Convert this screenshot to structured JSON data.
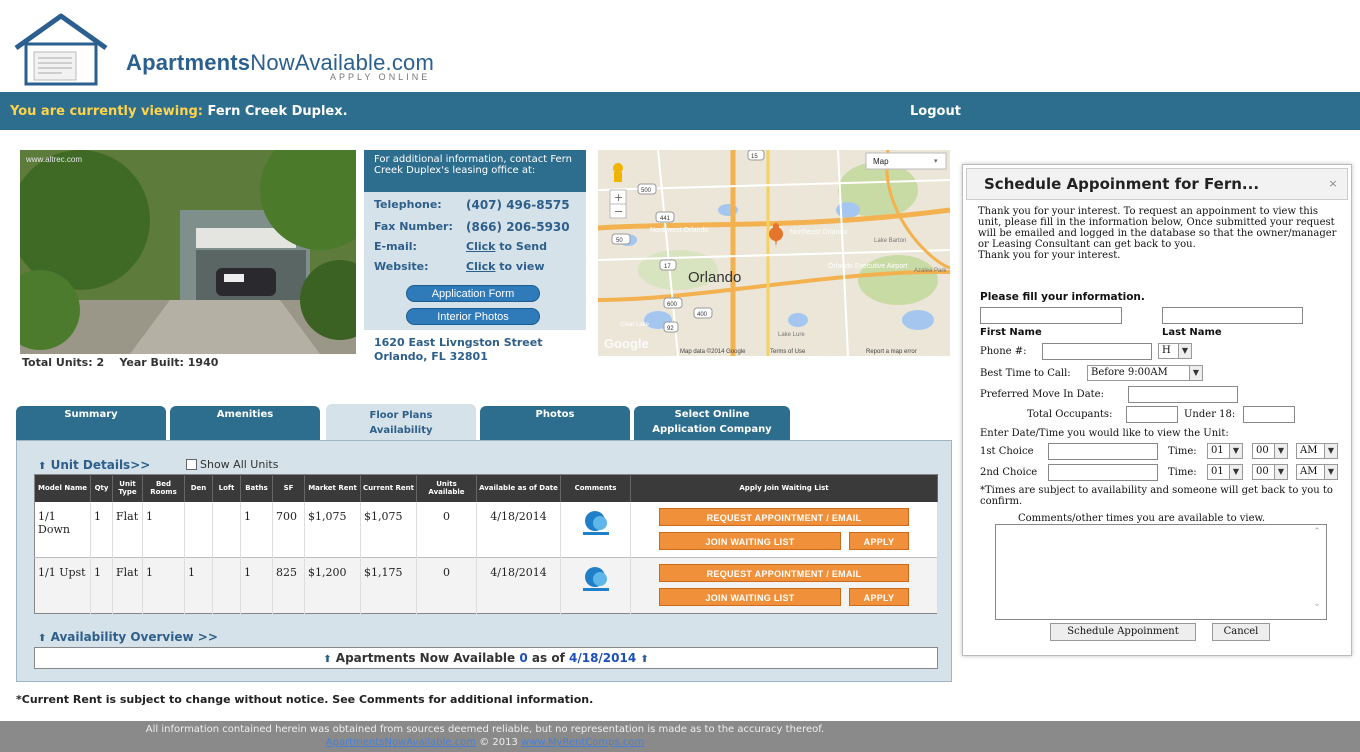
{
  "header": {
    "brand_bold": "Apartments",
    "brand_rest": "NowAvailable.com",
    "brand_sub": "APPLY ONLINE",
    "viewing_label": "You are currently viewing:",
    "viewing_value": "Fern Creek Duplex.",
    "logout": "Logout"
  },
  "property": {
    "photo_watermark": "www.altrec.com",
    "total_units": "Total Units: 2",
    "year_built": "Year Built: 1940",
    "contact_intro": "For additional information, contact Fern Creek Duplex's leasing office at:",
    "telephone_label": "Telephone:",
    "telephone": "(407) 496-8575",
    "fax_label": "Fax Number:",
    "fax": "(866) 206-5930",
    "email_label": "E-mail:",
    "email_link_click": "Click",
    "email_link_rest": " to Send",
    "website_label": "Website:",
    "website_link_click": "Click",
    "website_link_rest": " to view",
    "application_form": "Application Form",
    "interior_photos": "Interior Photos",
    "address_line1": "1620 East Livngston Street",
    "address_line2": "Orlando, FL 32801"
  },
  "map": {
    "type_button": "Map",
    "city_label": "Orlando",
    "labels": [
      "Northwest Orlando",
      "Northeast Orlando",
      "Orlando Executive Airport",
      "Lake Barton",
      "Clear Lake",
      "Lake Lure",
      "Azalea Park"
    ],
    "shields": [
      "500",
      "441",
      "50",
      "17",
      "600",
      "400",
      "92",
      "15"
    ],
    "zoom_in": "+",
    "zoom_out": "−",
    "google": "Google",
    "attribution": "Map data ©2014 Google",
    "terms": "Terms of Use",
    "report": "Report a map error"
  },
  "tabs": [
    {
      "line1": "Summary",
      "line2": ""
    },
    {
      "line1": "Amenities",
      "line2": ""
    },
    {
      "line1": "Floor Plans",
      "line2": "Availability"
    },
    {
      "line1": "Photos",
      "line2": ""
    },
    {
      "line1": "Select Online",
      "line2": "Application Company"
    }
  ],
  "unit_details": {
    "title": "Unit Details>>",
    "show_all": "Show All Units",
    "columns": [
      "Model Name",
      "Qty",
      "Unit Type",
      "Bed Rooms",
      "Den",
      "Loft",
      "Baths",
      "SF",
      "Market Rent",
      "Current Rent",
      "Units Available",
      "Available as of Date",
      "Comments",
      "Apply Join Waiting List"
    ],
    "rows": [
      {
        "model": "1/1 Down",
        "qty": "1",
        "type": "Flat",
        "bed": "1",
        "den": "",
        "loft": "",
        "baths": "1",
        "sf": "700",
        "market": "$1,075",
        "current": "$1,075",
        "available": "0",
        "date": "4/18/2014"
      },
      {
        "model": "1/1 Upst",
        "qty": "1",
        "type": "Flat",
        "bed": "1",
        "den": "1",
        "loft": "",
        "baths": "1",
        "sf": "825",
        "market": "$1,200",
        "current": "$1,175",
        "available": "0",
        "date": "4/18/2014"
      }
    ],
    "request_btn": "REQUEST APPOINTMENT / EMAIL",
    "waiting_btn": "JOIN WAITING LIST",
    "apply_btn": "APPLY",
    "comments_icon_label": "Comments"
  },
  "availability": {
    "title": "Availability Overview >>",
    "bar_prefix": "Apartments Now Available",
    "count": "0",
    "as_of": "as of",
    "date": "4/18/2014"
  },
  "note": "*Current Rent is subject to change without notice. See Comments for additional information.",
  "footer": {
    "disclaimer": "All information contained herein was obtained from sources deemed reliable, but no representation is made as to the accuracy thereof.",
    "link1": "ApartmentsNowAvailable.com",
    "copyright": " © 2013 ",
    "link2": "www.MyRentComps.com"
  },
  "modal": {
    "title": "Schedule Appoinment for Fern...",
    "close": "×",
    "intro": "Thank you for your interest. To request an appoinment to view this unit, please fill in the information below, Once submitted your request will be emailed and logged in the database so that the owner/manager or Leasing Consultant can get back to you.",
    "intro2": "Thank you for your interest.",
    "fill_info": "Please fill your information.",
    "first_name": "First Name",
    "last_name": "Last Name",
    "phone_label": "Phone #:",
    "phone_type": "H",
    "best_time_label": "Best Time to Call:",
    "best_time": "Before 9:00AM",
    "move_in_label": "Preferred Move In Date:",
    "occupants_label": "Total Occupants:",
    "under18_label": "Under 18:",
    "datetime_label": "Enter Date/Time you would like to view the Unit:",
    "choice1": "1st Choice",
    "choice2": "2nd Choice",
    "time_label": "Time:",
    "hour": "01",
    "minute": "00",
    "ampm": "AM",
    "times_note": "*Times are subject to availability and someone will get back to you to confirm.",
    "comments_label": "Comments/other times you are available to view.",
    "submit": "Schedule Appoinment",
    "cancel": "Cancel"
  }
}
